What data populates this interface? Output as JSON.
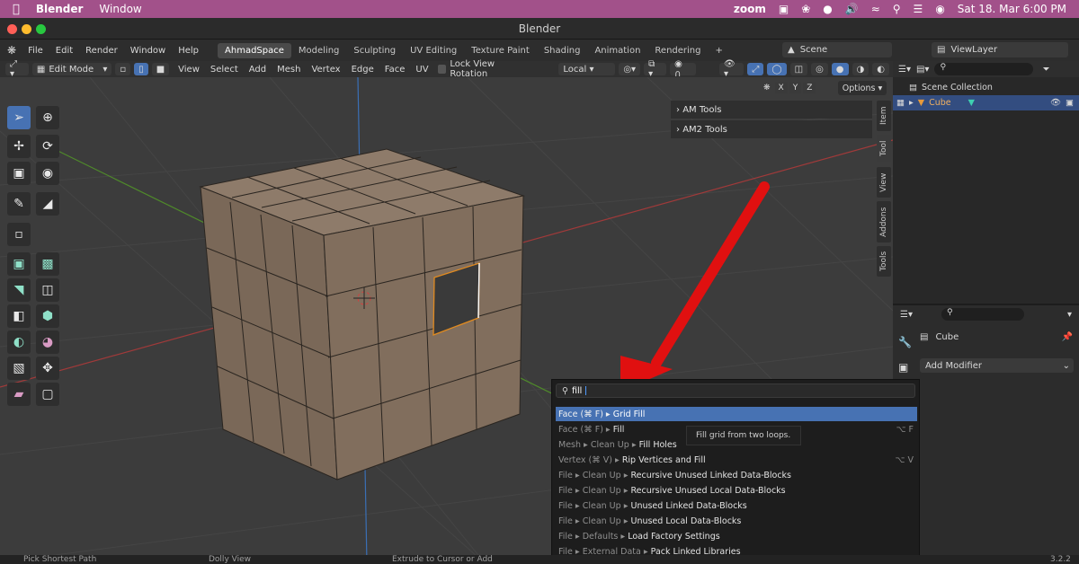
{
  "macbar": {
    "app": "Blender",
    "window": "Window",
    "zoom": "zoom",
    "clock": "Sat 18. Mar  6:00 PM"
  },
  "window": {
    "title": "Blender"
  },
  "menu": [
    "File",
    "Edit",
    "Render",
    "Window",
    "Help"
  ],
  "workspaces": [
    "AhmadSpace",
    "Modeling",
    "Sculpting",
    "UV Editing",
    "Texture Paint",
    "Shading",
    "Animation",
    "Rendering"
  ],
  "scene": {
    "name": "Scene",
    "viewlayer": "ViewLayer"
  },
  "header": {
    "mode": "Edit Mode",
    "menus": [
      "View",
      "Select",
      "Add",
      "Mesh",
      "Vertex",
      "Edge",
      "Face",
      "UV"
    ],
    "lock_view": "Lock View Rotation",
    "orientation": "Local"
  },
  "viewport": {
    "axes": [
      "X",
      "Y",
      "Z"
    ],
    "options": "Options"
  },
  "npanel": [
    "AM Tools",
    "AM2 Tools"
  ],
  "sidetabs": [
    "Item",
    "Tool",
    "View",
    "Addons",
    "Tools"
  ],
  "outliner": {
    "collection": "Scene Collection",
    "object": "Cube"
  },
  "props": {
    "object": "Cube",
    "add_modifier": "Add Modifier"
  },
  "search": {
    "query": "fill",
    "tooltip": "Fill grid from two loops.",
    "results": [
      {
        "path": "Face (⌘ F)",
        "name": "Grid Fill",
        "shortcut": ""
      },
      {
        "path": "Face (⌘ F)",
        "name": "Fill",
        "shortcut": "⌥ F"
      },
      {
        "path": "Mesh ▸ Clean Up",
        "name": "Fill Holes",
        "shortcut": ""
      },
      {
        "path": "Vertex (⌘ V)",
        "name": "Rip Vertices and Fill",
        "shortcut": "⌥ V"
      },
      {
        "path": "File ▸ Clean Up",
        "name": "Recursive Unused Linked Data-Blocks",
        "shortcut": ""
      },
      {
        "path": "File ▸ Clean Up",
        "name": "Recursive Unused Local Data-Blocks",
        "shortcut": ""
      },
      {
        "path": "File ▸ Clean Up",
        "name": "Unused Linked Data-Blocks",
        "shortcut": ""
      },
      {
        "path": "File ▸ Clean Up",
        "name": "Unused Local Data-Blocks",
        "shortcut": ""
      },
      {
        "path": "File ▸ Defaults",
        "name": "Load Factory Settings",
        "shortcut": ""
      },
      {
        "path": "File ▸ External Data",
        "name": "Pack Linked Libraries",
        "shortcut": ""
      }
    ]
  },
  "status": {
    "0": "Pick Shortest Path",
    "1": "Dolly View",
    "2": "Extrude to Cursor or Add",
    "version": "3.2.2"
  },
  "colors": {
    "accent": "#4772b3",
    "mac_bar": "#a2518a",
    "selection": "#e08a20",
    "annotation_arrow": "#e01010"
  }
}
